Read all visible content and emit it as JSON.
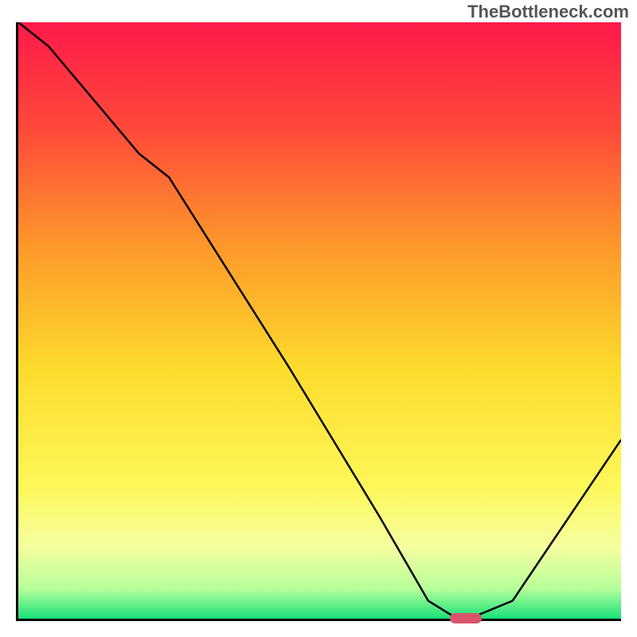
{
  "watermark": "TheBottleneck.com",
  "chart_data": {
    "type": "line",
    "title": "",
    "xlabel": "",
    "ylabel": "",
    "x_range": [
      0,
      100
    ],
    "y_range": [
      0,
      100
    ],
    "bg_gradient": {
      "stops": [
        {
          "offset": 0,
          "color": "#ff1a4b"
        },
        {
          "offset": 0.18,
          "color": "#ff4a3a"
        },
        {
          "offset": 0.38,
          "color": "#fd9a2a"
        },
        {
          "offset": 0.58,
          "color": "#fddb2c"
        },
        {
          "offset": 0.78,
          "color": "#fdf85a"
        },
        {
          "offset": 0.88,
          "color": "#f5ffa0"
        },
        {
          "offset": 0.95,
          "color": "#b6ff9a"
        },
        {
          "offset": 1.0,
          "color": "#18e07a"
        }
      ]
    },
    "curve": {
      "name": "bottleneck-curve",
      "x": [
        0,
        5,
        20,
        25,
        45,
        60,
        68,
        72,
        76,
        82,
        100
      ],
      "y": [
        100,
        96,
        78,
        74,
        42,
        17,
        3,
        0.5,
        0.5,
        3,
        30
      ]
    },
    "marker": {
      "x": 74,
      "y": 0.5,
      "color": "#d9536b"
    }
  }
}
